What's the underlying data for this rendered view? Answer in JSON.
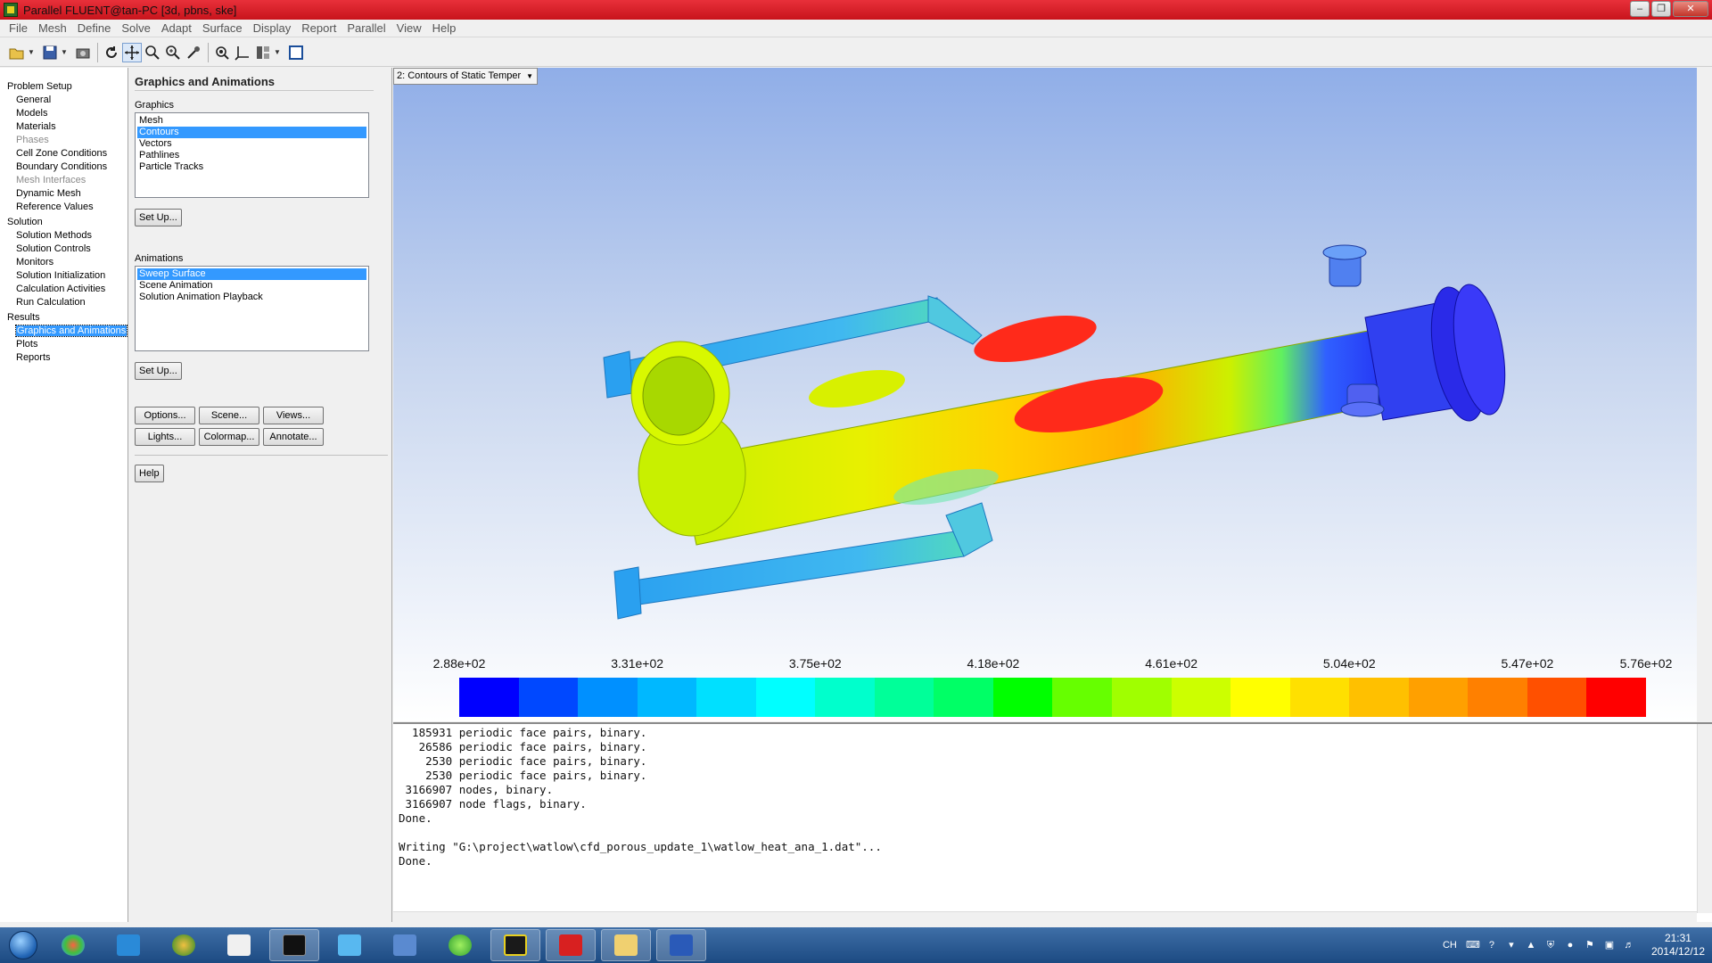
{
  "window": {
    "title": "Parallel FLUENT@tan-PC  [3d, pbns, ske]"
  },
  "menu": [
    "File",
    "Mesh",
    "Define",
    "Solve",
    "Adapt",
    "Surface",
    "Display",
    "Report",
    "Parallel",
    "View",
    "Help"
  ],
  "nav": {
    "groups": [
      {
        "label": "Problem Setup",
        "items": [
          {
            "label": "General",
            "disabled": false
          },
          {
            "label": "Models",
            "disabled": false
          },
          {
            "label": "Materials",
            "disabled": false
          },
          {
            "label": "Phases",
            "disabled": true
          },
          {
            "label": "Cell Zone Conditions",
            "disabled": false
          },
          {
            "label": "Boundary Conditions",
            "disabled": false
          },
          {
            "label": "Mesh Interfaces",
            "disabled": true
          },
          {
            "label": "Dynamic Mesh",
            "disabled": false
          },
          {
            "label": "Reference Values",
            "disabled": false
          }
        ]
      },
      {
        "label": "Solution",
        "items": [
          {
            "label": "Solution Methods",
            "disabled": false
          },
          {
            "label": "Solution Controls",
            "disabled": false
          },
          {
            "label": "Monitors",
            "disabled": false
          },
          {
            "label": "Solution Initialization",
            "disabled": false
          },
          {
            "label": "Calculation Activities",
            "disabled": false
          },
          {
            "label": "Run Calculation",
            "disabled": false
          }
        ]
      },
      {
        "label": "Results",
        "items": [
          {
            "label": "Graphics and Animations",
            "disabled": false,
            "selected": true
          },
          {
            "label": "Plots",
            "disabled": false
          },
          {
            "label": "Reports",
            "disabled": false
          }
        ]
      }
    ]
  },
  "panel": {
    "title": "Graphics and Animations",
    "graphics_label": "Graphics",
    "graphics_items": [
      "Mesh",
      "Contours",
      "Vectors",
      "Pathlines",
      "Particle Tracks"
    ],
    "graphics_selected": "Contours",
    "setup_label": "Set Up...",
    "animations_label": "Animations",
    "animation_items": [
      "Sweep Surface",
      "Scene Animation",
      "Solution Animation Playback"
    ],
    "animation_selected": "Sweep Surface",
    "buttons": [
      "Options...",
      "Scene...",
      "Views...",
      "Lights...",
      "Colormap...",
      "Annotate..."
    ],
    "help_label": "Help"
  },
  "graphics": {
    "display_select": "2: Contours of Static Temper",
    "colorbar_ticks": [
      "2.88e+02",
      "3.31e+02",
      "3.75e+02",
      "4.18e+02",
      "4.61e+02",
      "5.04e+02",
      "5.47e+02",
      "5.76e+02"
    ],
    "colorbar_colors": [
      "#0000ff",
      "#0048ff",
      "#0090ff",
      "#00b8ff",
      "#00e0ff",
      "#00ffff",
      "#00ffcc",
      "#00ff99",
      "#00ff66",
      "#00ff00",
      "#66ff00",
      "#a0ff00",
      "#ccff00",
      "#ffff00",
      "#ffe000",
      "#ffc000",
      "#ffa000",
      "#ff8000",
      "#ff5000",
      "#ff0000"
    ]
  },
  "console": {
    "lines": [
      "  185931 periodic face pairs, binary.",
      "   26586 periodic face pairs, binary.",
      "    2530 periodic face pairs, binary.",
      "    2530 periodic face pairs, binary.",
      " 3166907 nodes, binary.",
      " 3166907 node flags, binary.",
      "Done.",
      "",
      "Writing \"G:\\project\\watlow\\cfd_porous_update_1\\watlow_heat_ana_1.dat\"...",
      "Done."
    ]
  },
  "taskbar": {
    "time": "21:31",
    "date": "2014/12/12",
    "lang": "CH"
  }
}
